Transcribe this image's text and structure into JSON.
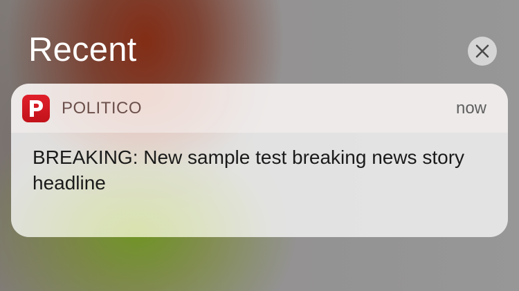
{
  "section": {
    "title": "Recent"
  },
  "clear_button": {
    "icon": "close-icon"
  },
  "notification": {
    "app_icon": "politico-app-icon",
    "app_icon_letter": "P",
    "app_name": "POLITICO",
    "timestamp": "now",
    "message": "BREAKING: New sample test breaking news story headline"
  },
  "colors": {
    "politico_red": "#d21920",
    "section_title": "#ffffff"
  }
}
